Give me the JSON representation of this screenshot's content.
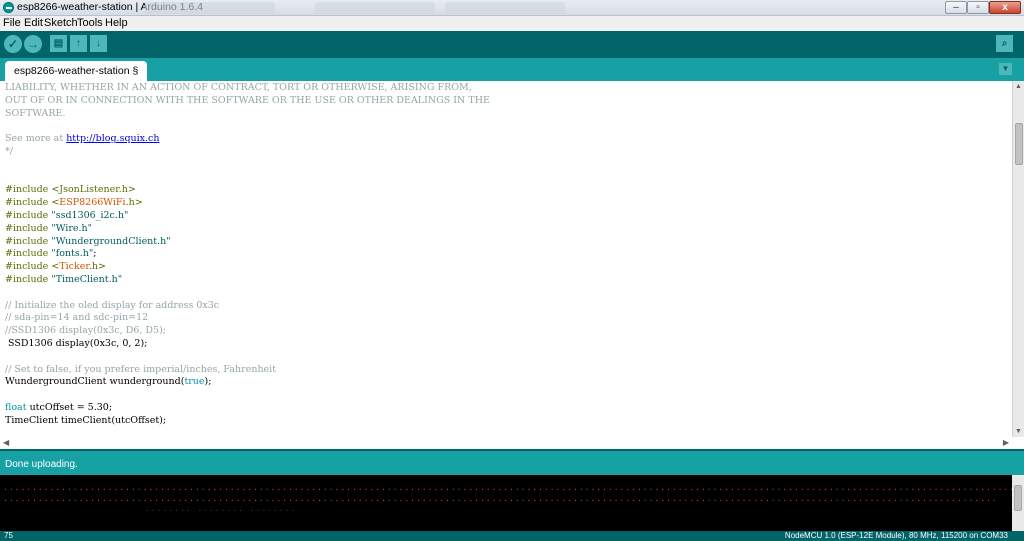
{
  "window": {
    "title": "esp8266-weather-station | Arduino 1.6.4",
    "controls": {
      "minimize": "–",
      "maximize": "▫",
      "close": "x"
    }
  },
  "menu": [
    "File",
    "Edit",
    "Sketch",
    "Tools",
    "Help"
  ],
  "toolbar": {
    "verify_icon": "✓",
    "upload_icon": "→",
    "new_icon": "▤",
    "open_icon": "↑",
    "save_icon": "↓",
    "serial_monitor_icon": "⌕"
  },
  "tab": {
    "label": "esp8266-weather-station §",
    "menu_icon": "▼"
  },
  "code_lines": [
    [
      {
        "t": "LIABILITY, WHETHER IN AN ACTION OF CONTRACT, TORT OR OTHERWISE, ARISING FROM,",
        "c": "cmt"
      }
    ],
    [
      {
        "t": "OUT OF OR IN CONNECTION WITH THE SOFTWARE OR THE USE OR OTHER DEALINGS IN THE",
        "c": "cmt"
      }
    ],
    [
      {
        "t": "SOFTWARE.",
        "c": "cmt"
      }
    ],
    [],
    [
      {
        "t": "See more at ",
        "c": "cmt"
      },
      {
        "t": "http://blog.squix.ch",
        "c": "url"
      }
    ],
    [
      {
        "t": "*/",
        "c": "cmt"
      }
    ],
    [],
    [],
    [
      {
        "t": "#include <JsonListener.h>",
        "c": "kw"
      }
    ],
    [
      {
        "t": "#include <",
        "c": "kw"
      },
      {
        "t": "ESP8266WiFi",
        "c": "lib"
      },
      {
        "t": ".h>",
        "c": "kw"
      }
    ],
    [
      {
        "t": "#include ",
        "c": "kw"
      },
      {
        "t": "\"ssd1306_i2c.h\"",
        "c": "str"
      }
    ],
    [
      {
        "t": "#include ",
        "c": "kw"
      },
      {
        "t": "\"Wire.h\"",
        "c": "str"
      }
    ],
    [
      {
        "t": "#include ",
        "c": "kw"
      },
      {
        "t": "\"WundergroundClient.h\"",
        "c": "str"
      }
    ],
    [
      {
        "t": "#include ",
        "c": "kw"
      },
      {
        "t": "\"fonts.h\"",
        "c": "str"
      },
      {
        "t": ";",
        "c": ""
      }
    ],
    [
      {
        "t": "#include <",
        "c": "kw"
      },
      {
        "t": "Ticker",
        "c": "lib"
      },
      {
        "t": ".h>",
        "c": "kw"
      }
    ],
    [
      {
        "t": "#include ",
        "c": "kw"
      },
      {
        "t": "\"TimeClient.h\"",
        "c": "str"
      }
    ],
    [],
    [
      {
        "t": "// Initialize the oled display for address 0x3c",
        "c": "cmt"
      }
    ],
    [
      {
        "t": "// sda-pin=14 and sdc-pin=12",
        "c": "cmt"
      }
    ],
    [
      {
        "t": "//SSD1306 display(0x3c, D6, D5);",
        "c": "cmt"
      }
    ],
    [
      {
        "t": " SSD1306 display(0x3c, 0, 2);",
        "c": ""
      }
    ],
    [],
    [
      {
        "t": "// Set to false, if you prefere imperial/inches, Fahrenheit",
        "c": "cmt"
      }
    ],
    [
      {
        "t": "WundergroundClient wunderground(",
        "c": ""
      },
      {
        "t": "true",
        "c": "ty"
      },
      {
        "t": ");",
        "c": ""
      }
    ],
    [],
    [
      {
        "t": "float",
        "c": "ty"
      },
      {
        "t": " utcOffset = 5.30;",
        "c": ""
      }
    ],
    [
      {
        "t": "TimeClient timeClient(utcOffset);",
        "c": ""
      }
    ]
  ],
  "status": {
    "message": "Done uploading."
  },
  "console": {
    "line1": "................................................................................................................................................................................................................",
    "line2": "...........................................................................................................................................................................",
    "line3": "........                              ........            ........"
  },
  "bottom": {
    "line_number": "75",
    "board": "NodeMCU 1.0 (ESP-12E Module), 80 MHz, 115200 on COM33"
  },
  "colors": {
    "toolbar": "#006468",
    "tabstrip": "#17a1a5",
    "comment": "#95a5a6",
    "keyword": "#5e6d03",
    "type": "#00979c",
    "console_text": "#d63c2c"
  }
}
